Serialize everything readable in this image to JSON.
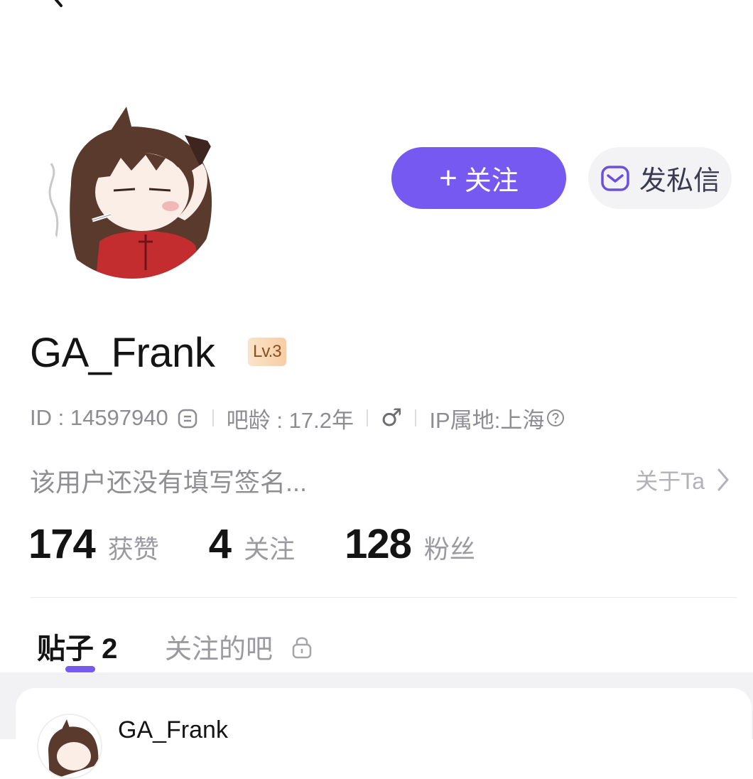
{
  "profile": {
    "username": "GA_Frank",
    "level": "Lv.3",
    "id_label": "ID : 14597940",
    "account_age": "吧龄 : 17.2年",
    "gender_symbol": "♂",
    "ip_location": "IP属地:上海",
    "signature": "该用户还没有填写签名..."
  },
  "actions": {
    "follow_label": "关注",
    "follow_prefix": "+",
    "message_label": "发私信",
    "about_label": "关于Ta"
  },
  "stats": {
    "likes_value": "174",
    "likes_label": "获赞",
    "following_value": "4",
    "following_label": "关注",
    "followers_value": "128",
    "followers_label": "粉丝"
  },
  "tabs": {
    "posts_label": "贴子 2",
    "followed_bars_label": "关注的吧"
  },
  "feed": {
    "first_post_author": "GA_Frank"
  },
  "colors": {
    "accent": "#7559f0",
    "text_primary": "#141414",
    "text_secondary": "#8c8c92"
  },
  "icons": [
    "back-chevron-icon",
    "mail-icon",
    "copy-icon",
    "male-icon",
    "help-circle-icon",
    "chevron-right-icon",
    "lock-icon"
  ]
}
